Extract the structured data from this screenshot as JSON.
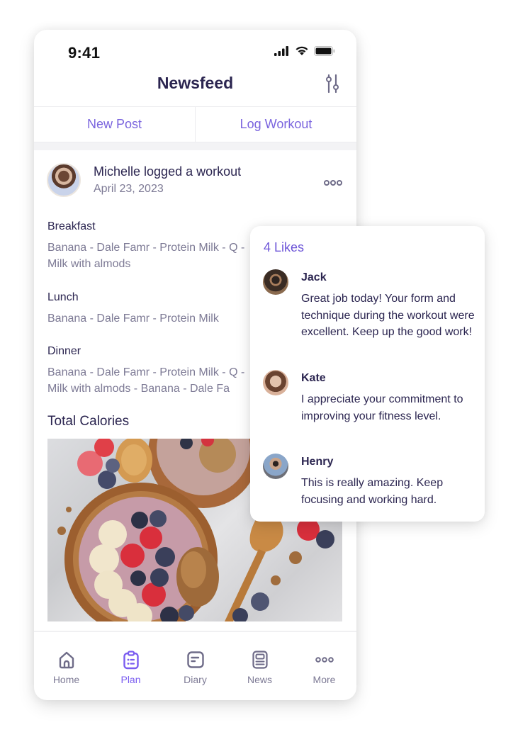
{
  "status_bar": {
    "time": "9:41",
    "icons": [
      "cellular-signal-icon",
      "wifi-icon",
      "battery-icon"
    ]
  },
  "header": {
    "title": "Newsfeed",
    "filter_icon": "sliders-icon"
  },
  "actions": {
    "new_post": "New Post",
    "log_workout": "Log Workout"
  },
  "post": {
    "author": "Michelle",
    "verb": " logged a ",
    "object": "workout",
    "date": "April 23, 2023",
    "more_icon": "more-horizontal-icon",
    "meals": [
      {
        "label": "Breakfast",
        "items": "Banana - Dale Famr - Protein Milk - Q - Milk with almods"
      },
      {
        "label": "Lunch",
        "items": "Banana - Dale Famr - Protein Milk"
      },
      {
        "label": "Dinner",
        "items": "Banana - Dale Famr - Protein Milk - Q - Milk with almods - Banana - Dale Fa"
      }
    ],
    "total_calories_label": "Total Calories",
    "photo_alt": "Acai smoothie bowl with banana, strawberries, blueberries and granola"
  },
  "likes_popover": {
    "title": "4 Likes",
    "comments": [
      {
        "name": "Jack",
        "text": "Great job today! Your form and technique during the workout were excellent. Keep up the good work!"
      },
      {
        "name": "Kate",
        "text": "I appreciate your commitment to improving your fitness level."
      },
      {
        "name": "Henry",
        "text": "This is really amazing. Keep focusing and working hard."
      }
    ]
  },
  "tab_bar": {
    "active": "Plan",
    "tabs": [
      {
        "label": "Home",
        "icon": "home-icon"
      },
      {
        "label": "Plan",
        "icon": "clipboard-icon"
      },
      {
        "label": "Diary",
        "icon": "diary-icon"
      },
      {
        "label": "News",
        "icon": "newspaper-icon"
      },
      {
        "label": "More",
        "icon": "more-horizontal-icon"
      }
    ]
  },
  "colors": {
    "accent": "#7a5cf0",
    "title_text": "#2b2550",
    "muted_text": "#7d7a95",
    "link": "#7a64de"
  }
}
